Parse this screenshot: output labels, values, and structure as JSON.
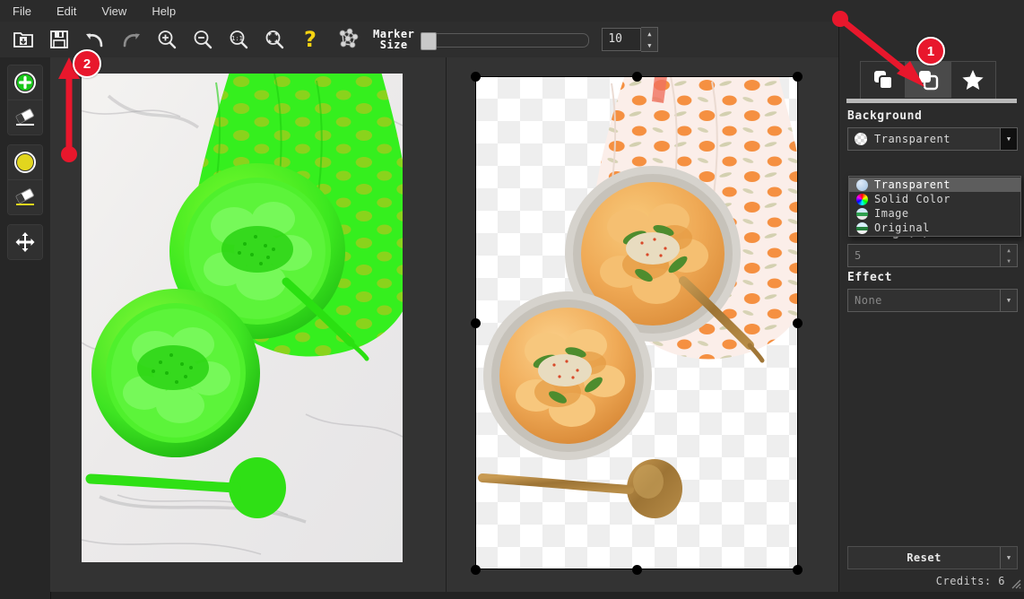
{
  "app": {
    "menubar": [
      "File",
      "Edit",
      "View",
      "Help"
    ],
    "toolbar": {
      "buttons": [
        {
          "name": "open-folder-button",
          "icon": "open-folder-icon"
        },
        {
          "name": "save-button",
          "icon": "floppy-disk-icon"
        },
        {
          "name": "undo-button",
          "icon": "undo-arrow-icon"
        },
        {
          "name": "redo-button",
          "icon": "redo-arrow-icon"
        },
        {
          "name": "zoom-in-button",
          "icon": "magnifier-plus-icon"
        },
        {
          "name": "zoom-out-button",
          "icon": "magnifier-minus-icon"
        },
        {
          "name": "zoom-actual-button",
          "icon": "magnifier-one-to-one-icon"
        },
        {
          "name": "zoom-fit-button",
          "icon": "magnifier-fit-icon"
        },
        {
          "name": "help-button",
          "icon": "question-mark-icon"
        },
        {
          "name": "network-button",
          "icon": "node-graph-icon"
        }
      ],
      "marker_size_label_line1": "Marker",
      "marker_size_label_line2": "Size",
      "marker_size_value": "10",
      "slider_percent": 3
    },
    "left_rail": [
      {
        "name": "add-marker-tool",
        "icon": "green-plus-circle-icon"
      },
      {
        "name": "erase-green-marker-tool",
        "icon": "eraser-green-icon"
      },
      {
        "name": "yellow-marker-tool",
        "icon": "yellow-circle-icon"
      },
      {
        "name": "erase-yellow-marker-tool",
        "icon": "eraser-yellow-icon"
      },
      {
        "name": "pan-tool",
        "icon": "move-arrows-icon"
      }
    ],
    "panel": {
      "tabs": [
        {
          "name": "tab-original",
          "icon": "copy-layers-icon",
          "active": false
        },
        {
          "name": "tab-background",
          "icon": "copy-layers-filled-icon",
          "active": true
        },
        {
          "name": "tab-effects",
          "icon": "star-icon",
          "active": false
        }
      ],
      "background_label": "Background",
      "background_value": "Transparent",
      "background_options": [
        {
          "label": "Transparent",
          "swatch": "transparent",
          "selected": true
        },
        {
          "label": "Solid Color",
          "swatch": "colorwheel",
          "selected": false
        },
        {
          "label": "Image",
          "swatch": "image",
          "selected": false
        },
        {
          "label": "Original",
          "swatch": "original",
          "selected": false
        }
      ],
      "padding_label": "Padding (%)",
      "padding_value": "5",
      "effect_label": "Effect",
      "effect_value": "None",
      "reset_label": "Reset",
      "credits_label": "Credits: 6"
    },
    "annotations": [
      {
        "name": "annotation-badge-1",
        "number": "1"
      },
      {
        "name": "annotation-badge-2",
        "number": "2"
      }
    ],
    "colors": {
      "accent_red": "#e8172c",
      "marker_green": "#2ee82e",
      "marker_yellow": "#e8dc28",
      "panel_bg": "#2b2b2b",
      "canvas_bg": "#333333"
    }
  }
}
